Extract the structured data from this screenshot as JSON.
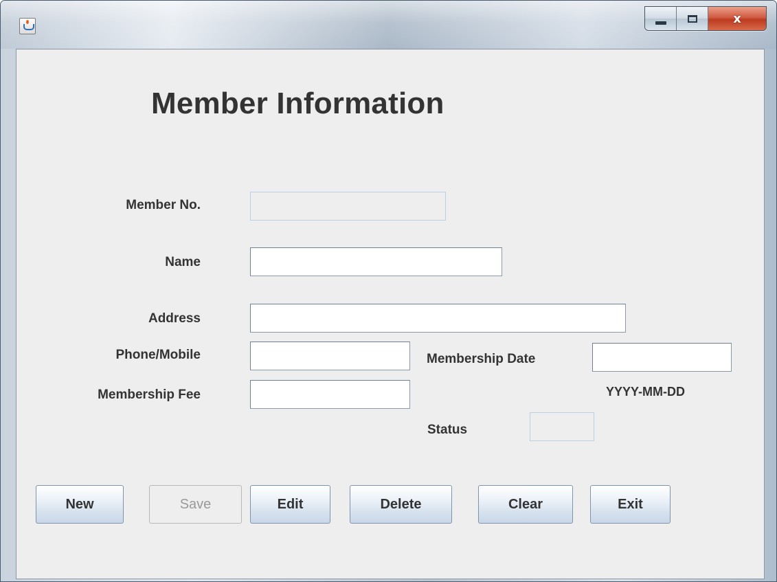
{
  "window": {
    "icon": "java-app-icon",
    "close_glyph": "x"
  },
  "form": {
    "title": "Member Information",
    "fields": {
      "member_no": {
        "label": "Member No.",
        "value": ""
      },
      "name": {
        "label": "Name",
        "value": ""
      },
      "address": {
        "label": "Address",
        "value": ""
      },
      "phone": {
        "label": "Phone/Mobile",
        "value": ""
      },
      "membership_fee": {
        "label": "Membership Fee",
        "value": ""
      },
      "membership_date": {
        "label": "Membership Date",
        "value": "",
        "hint": "YYYY-MM-DD"
      },
      "status": {
        "label": "Status",
        "value": ""
      }
    }
  },
  "buttons": {
    "new": "New",
    "save": "Save",
    "edit": "Edit",
    "delete": "Delete",
    "clear": "Clear",
    "exit": "Exit"
  },
  "colors": {
    "panel_bg": "#eeeeee",
    "text": "#333333",
    "button_gradient_bottom": "#c9d7e8",
    "close_button": "#c9452a"
  }
}
